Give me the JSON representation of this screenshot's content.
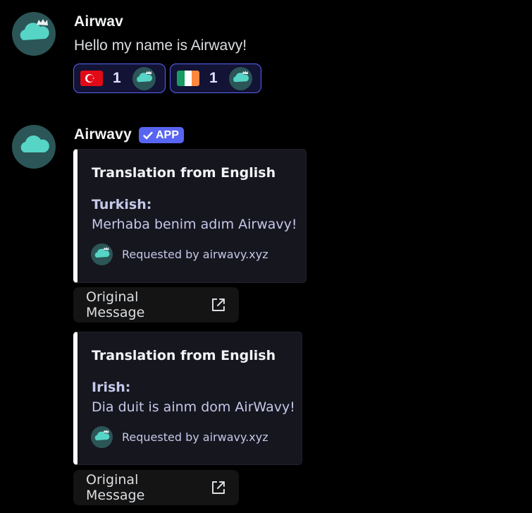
{
  "messages": [
    {
      "author": "Airwav",
      "text": "Hello my name is Airwavy!",
      "reactions": [
        {
          "emoji": "turkey-flag-icon",
          "count": "1"
        },
        {
          "emoji": "ireland-flag-icon",
          "count": "1"
        }
      ]
    },
    {
      "author": "Airwavy",
      "badge": "APP",
      "embeds": [
        {
          "title": "Translation from English",
          "field_name": "Turkish:",
          "field_value": "Merhaba benim adım Airwavy!",
          "footer": "Requested by airwavy.xyz",
          "button_label": "Original Message"
        },
        {
          "title": "Translation from English",
          "field_name": "Irish:",
          "field_value": "Dia duit is ainm dom AirWavy!",
          "footer": "Requested by airwavy.xyz",
          "button_label": "Original Message"
        }
      ]
    }
  ],
  "colors": {
    "background": "#000000",
    "reaction_border": "#5865f2",
    "badge": "#5865f2",
    "embed_bar": "#ffffff",
    "avatar": "#2b5556",
    "cloud": "#56d4c6"
  }
}
